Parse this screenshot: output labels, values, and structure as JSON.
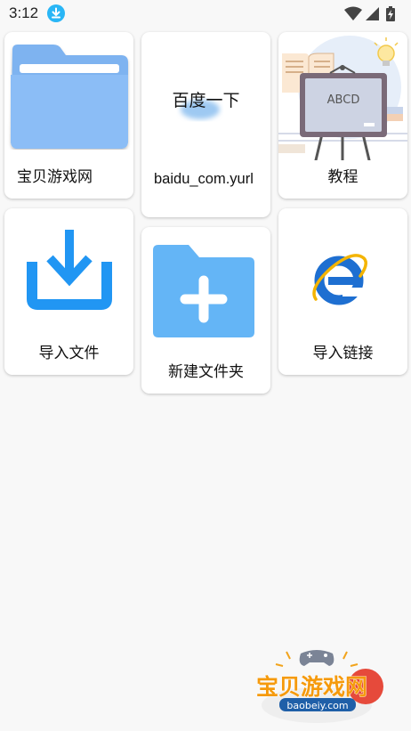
{
  "status_bar": {
    "time": "3:12",
    "icons": [
      "download-icon",
      "wifi-icon",
      "cellular-signal-icon",
      "battery-charging-icon"
    ]
  },
  "grid": {
    "items": [
      {
        "label": "宝贝游戏网",
        "icon": "folder-icon"
      },
      {
        "label": "baidu_com.yurl",
        "preview_text": "百度一下",
        "icon": "baidu-preview"
      },
      {
        "label": "教程",
        "icon": "tutorial-blackboard-icon",
        "board_text": "ABCD"
      },
      {
        "label": "导入文件",
        "icon": "import-file-icon"
      },
      {
        "label": "新建文件夹",
        "icon": "new-folder-icon"
      },
      {
        "label": "导入链接",
        "icon": "internet-explorer-icon"
      }
    ]
  },
  "watermark": {
    "title": "宝贝游戏网",
    "url": "baobeiy.com"
  },
  "colors": {
    "accent_blue": "#2196f3",
    "folder_blue": "#7fb7f5",
    "new_folder_blue": "#64b5f6",
    "watermark_orange": "#f59a0c"
  }
}
